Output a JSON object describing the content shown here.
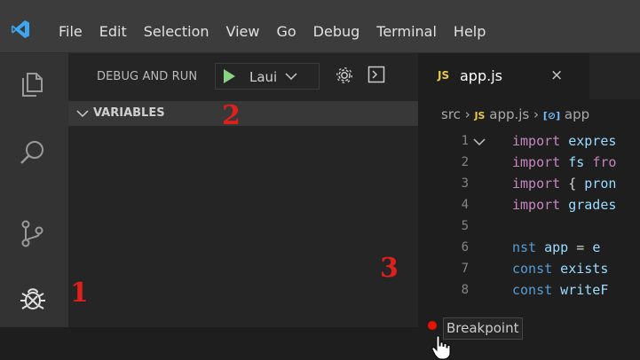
{
  "menu": [
    "File",
    "Edit",
    "Selection",
    "View",
    "Go",
    "Debug",
    "Terminal",
    "Help"
  ],
  "sidebar": {
    "title": "DEBUG AND RUN",
    "launch_config": "Laui",
    "section": "VARIABLES"
  },
  "editor": {
    "tab": {
      "badge": "JS",
      "filename": "app.js",
      "close": "×"
    },
    "breadcrumbs": {
      "folder": "src",
      "file_badge": "JS",
      "file": "app.js",
      "symbol_badge": "[⊘]",
      "symbol": "app"
    },
    "lines": [
      {
        "num": "1",
        "tokens": [
          {
            "t": "import",
            "c": "kw"
          },
          {
            "t": " expres",
            "c": "id"
          }
        ]
      },
      {
        "num": "2",
        "tokens": [
          {
            "t": "import",
            "c": "kw"
          },
          {
            "t": " fs ",
            "c": "id"
          },
          {
            "t": "fro",
            "c": "kw"
          }
        ]
      },
      {
        "num": "3",
        "tokens": [
          {
            "t": "import",
            "c": "kw"
          },
          {
            "t": " { ",
            "c": "pl"
          },
          {
            "t": "pron",
            "c": "id"
          }
        ]
      },
      {
        "num": "4",
        "tokens": [
          {
            "t": "import",
            "c": "kw"
          },
          {
            "t": " grades",
            "c": "id"
          }
        ]
      },
      {
        "num": "5",
        "tokens": []
      },
      {
        "num": "6",
        "tokens": [
          {
            "t": "nst",
            "c": "kw2"
          },
          {
            "t": " app",
            "c": "id"
          },
          {
            "t": " = ",
            "c": "pl"
          },
          {
            "t": "e",
            "c": "id"
          }
        ]
      },
      {
        "num": "7",
        "tokens": [
          {
            "t": "const",
            "c": "kw2"
          },
          {
            "t": " exists",
            "c": "id"
          }
        ]
      },
      {
        "num": "8",
        "tokens": [
          {
            "t": "const",
            "c": "kw2"
          },
          {
            "t": " writeF",
            "c": "id"
          }
        ]
      }
    ],
    "breakpoint_tooltip": "Breakpoint"
  },
  "annotations": [
    "1",
    "2",
    "3"
  ],
  "colors": {
    "accent_green": "#89d185",
    "breakpoint_red": "#e51400",
    "annotation_red": "#e0201a",
    "js_yellow": "#e7c84b"
  }
}
